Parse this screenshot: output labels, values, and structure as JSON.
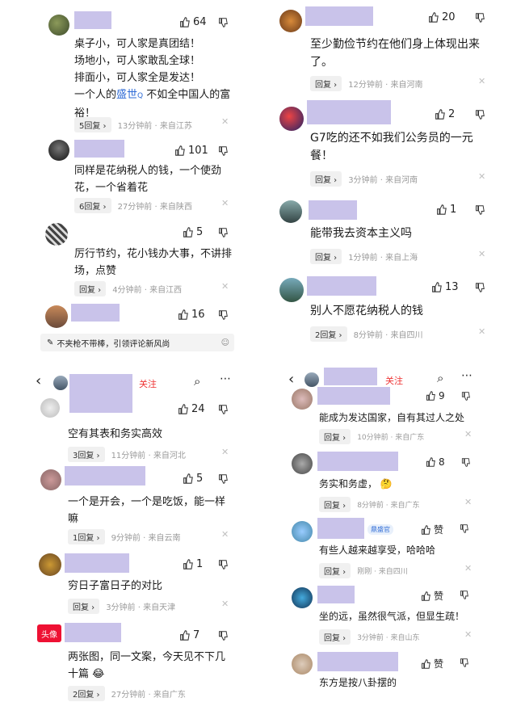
{
  "panel1": {
    "comments": [
      {
        "likes": "64",
        "lines": [
          "桌子小，可人家是真团结！",
          "场地小，可人家敢乱全球！",
          "排面小，可人家全是发达！",
          "一个人的",
          "不如全中国人的富",
          "裕！"
        ],
        "link": "盛世",
        "reply": "5回复",
        "time": "13分钟前 · 来自江苏"
      },
      {
        "likes": "101",
        "lines": [
          "同样是花纳税人的钱，一个使劲",
          "花，一个省着花"
        ],
        "reply": "6回复",
        "time": "27分钟前 · 来自陕西"
      },
      {
        "likes": "5",
        "lines": [
          "厉行节约，花小钱办大事，不讲排",
          "场，点赞"
        ],
        "reply": "回复",
        "time": "4分钟前 · 来自江西"
      },
      {
        "likes": "16"
      }
    ],
    "input_placeholder": "不夹枪不带棒，引领评论新风尚"
  },
  "panel2": {
    "comments": [
      {
        "likes": "20",
        "lines": [
          "至少勤俭节约在他们身上体现出来",
          "了。"
        ],
        "reply": "回复",
        "time": "12分钟前 · 来自河南"
      },
      {
        "likes": "2",
        "lines": [
          "G7吃的还不如我们公务员的一元",
          "餐！"
        ],
        "reply": "回复",
        "time": "3分钟前 · 来自河南"
      },
      {
        "likes": "1",
        "lines": [
          "能带我去资本主义吗"
        ],
        "reply": "回复",
        "time": "1分钟前 · 来自上海"
      },
      {
        "likes": "13",
        "lines": [
          "别人不愿花纳税人的钱"
        ],
        "reply": "2回复",
        "time": "8分钟前 · 来自四川"
      }
    ]
  },
  "panel3": {
    "follow": "关注",
    "comments": [
      {
        "likes": "24",
        "lines": [
          "空有其表和务实高效"
        ],
        "reply": "3回复",
        "time": "11分钟前 · 来自河北"
      },
      {
        "likes": "5",
        "lines": [
          "一个是开会，一个是吃饭，能一样",
          "嘛"
        ],
        "reply": "1回复",
        "time": "9分钟前 · 来自云南"
      },
      {
        "likes": "1",
        "lines": [
          "穷日子富日子的对比"
        ],
        "reply": "回复",
        "time": "3分钟前 · 来自天津"
      },
      {
        "likes": "7",
        "lines": [
          "两张图，同一文案，今天见不下几",
          "十篇"
        ],
        "reply": "2回复",
        "time": "27分钟前 · 来自广东",
        "avatar_text": "头像"
      }
    ]
  },
  "panel4": {
    "follow": "关注",
    "comments": [
      {
        "likes": "9",
        "lines": [
          "能成为发达国家，自有其过人之处"
        ],
        "reply": "回复",
        "time": "10分钟前 · 来自广东"
      },
      {
        "likes": "8",
        "lines": [
          "务实和务虚，"
        ],
        "reply": "回复",
        "time": "8分钟前 · 来自广东"
      },
      {
        "likes": "赞",
        "badge": "鼎盛官",
        "lines": [
          "有些人越来越享受，哈哈哈"
        ],
        "reply": "回复",
        "time": "刚刚 · 来自四川"
      },
      {
        "likes": "赞",
        "lines": [
          "坐的远，虽然很气派，但显生疏！"
        ],
        "reply": "回复",
        "time": "3分钟前 · 来自山东"
      },
      {
        "likes": "赞",
        "lines": [
          "东方是按八卦摆的"
        ]
      }
    ]
  },
  "colors": {
    "name_block": "#c9c3ea",
    "link": "#2f6bd6",
    "follow": "#e33333"
  }
}
